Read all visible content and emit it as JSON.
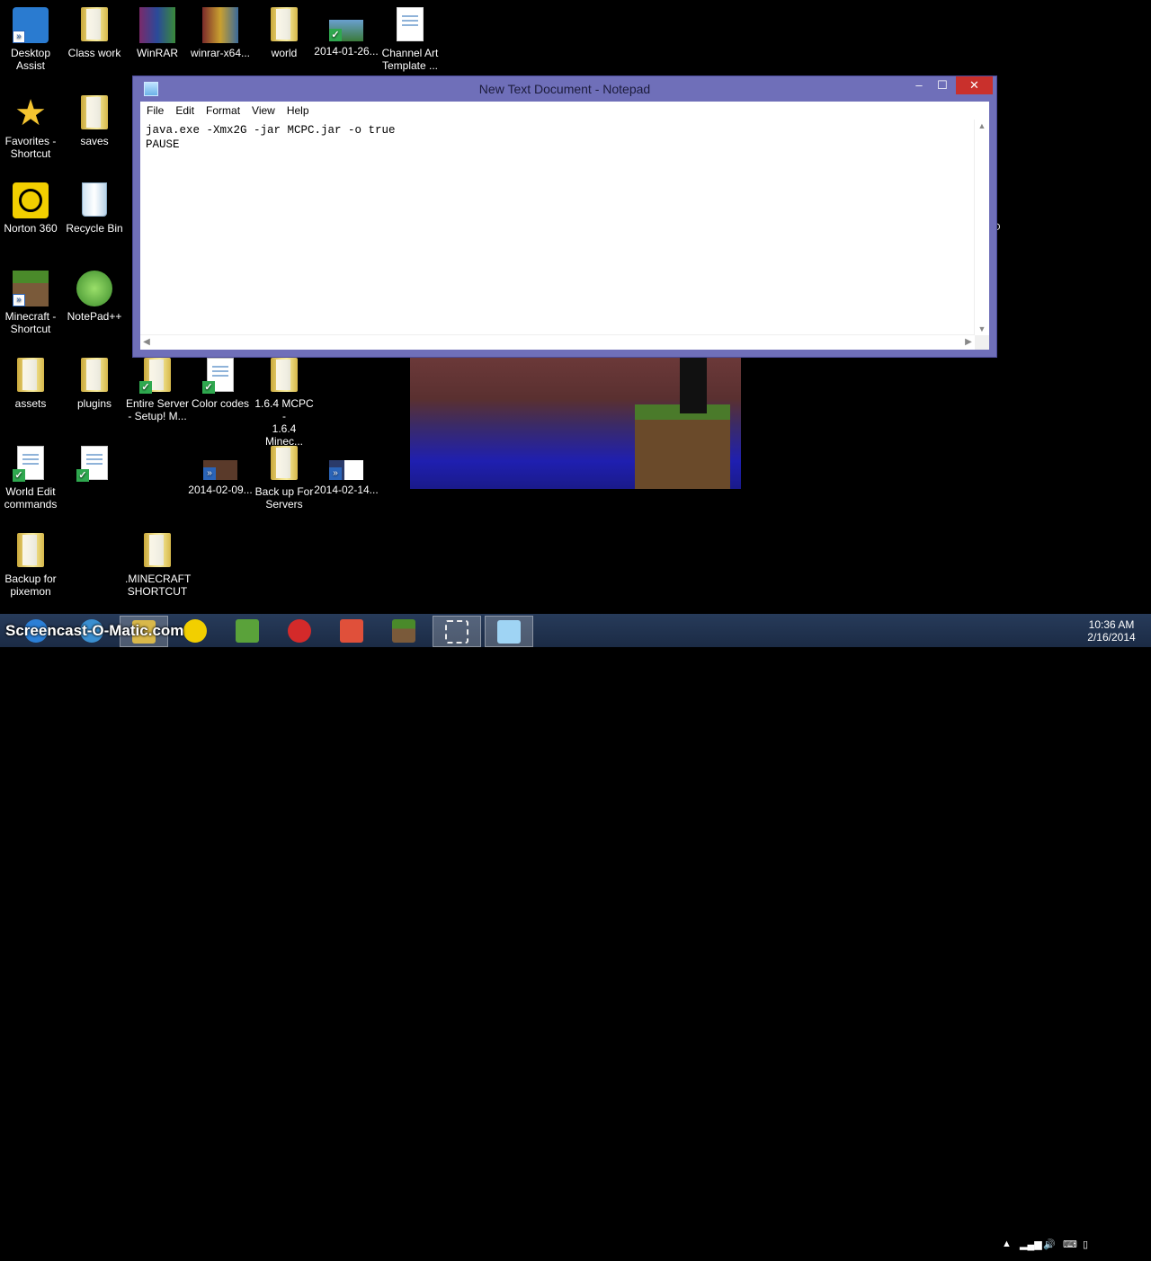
{
  "desktop": {
    "icons": [
      {
        "label": "Desktop\nAssist",
        "icon": "desktop-assist-icon"
      },
      {
        "label": "Class work",
        "icon": "folder-icon"
      },
      {
        "label": "WinRAR",
        "icon": "winrar-icon"
      },
      {
        "label": "winrar-x64...",
        "icon": "winrar-installer-icon"
      },
      {
        "label": "world",
        "icon": "folder-icon"
      },
      {
        "label": "2014-01-26...",
        "icon": "image-icon"
      },
      {
        "label": "Channel Art\nTemplate ...",
        "icon": "blank-file-icon"
      },
      {
        "label": "Favorites -\nShortcut",
        "icon": "star-icon"
      },
      {
        "label": "saves",
        "icon": "folder-icon"
      },
      {
        "label": "Norton 360",
        "icon": "norton-icon"
      },
      {
        "label": "Recycle Bin",
        "icon": "recycle-bin-icon"
      },
      {
        "label": "Minecraft -\nShortcut",
        "icon": "minecraft-icon"
      },
      {
        "label": "NotePad++",
        "icon": "notepadpp-icon"
      },
      {
        "label": "assets",
        "icon": "folder-icon"
      },
      {
        "label": "plugins",
        "icon": "folder-icon"
      },
      {
        "label": "Entire Server\n- Setup! M...",
        "icon": "folder-icon"
      },
      {
        "label": "Color codes",
        "icon": "document-icon"
      },
      {
        "label": "1.6.4 MCPC -\n1.6.4 Minec...",
        "icon": "folder-icon"
      },
      {
        "label": "World Edit\ncommands",
        "icon": "document-icon"
      },
      {
        "label": "",
        "icon": "script-icon"
      },
      {
        "label": "2014-02-09...",
        "icon": "video-icon"
      },
      {
        "label": "Back up For\nServers",
        "icon": "folder-icon"
      },
      {
        "label": "2014-02-14...",
        "icon": "video-icon"
      },
      {
        "label": "Backup for\npixemon",
        "icon": "folder-icon"
      },
      {
        "label": ".MINECRAFT\nSHORTCUT",
        "icon": "folder-icon"
      }
    ],
    "stray_text": "O\n."
  },
  "notepad": {
    "title": "New Text Document - Notepad",
    "buttons": {
      "minimize": "–",
      "maximize": "☐",
      "close": "✕"
    },
    "menu": [
      "File",
      "Edit",
      "Format",
      "View",
      "Help"
    ],
    "content": "java.exe -Xmx2G -jar MCPC.jar -o true\nPAUSE"
  },
  "taskbar": {
    "watermark": "Screencast-O-Matic.com",
    "items": [
      {
        "name": "ie-icon",
        "color": "#2b7fd6"
      },
      {
        "name": "ie-icon-2",
        "color": "#3a8fd0"
      },
      {
        "name": "file-explorer-icon",
        "color": "#d9b84a"
      },
      {
        "name": "norton-icon",
        "color": "#f2cf00"
      },
      {
        "name": "wunderlist-icon",
        "color": "#5aa23a"
      },
      {
        "name": "tunngle-icon",
        "color": "#d42a2a"
      },
      {
        "name": "todoist-icon",
        "color": "#e0503a"
      },
      {
        "name": "minecraft-icon",
        "color": "#5a8a2a"
      },
      {
        "name": "snipping-tool-icon",
        "color": "#dddddd"
      },
      {
        "name": "notepad-icon",
        "color": "#9fd4f4"
      }
    ],
    "clock_time": "10:36 AM",
    "clock_date": "2/16/2014"
  }
}
